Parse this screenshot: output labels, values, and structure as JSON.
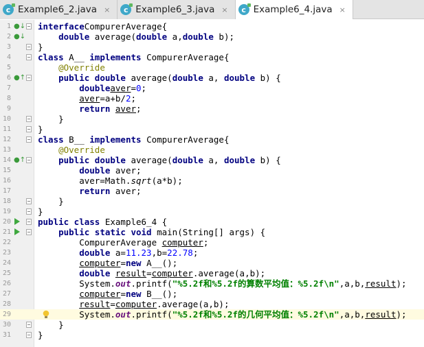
{
  "tabs": [
    {
      "icon": "class-icon",
      "label": "Example6_2.java",
      "active": false
    },
    {
      "icon": "class-icon",
      "label": "Example6_3.java",
      "active": false
    },
    {
      "icon": "class-icon",
      "label": "Example6_4.java",
      "active": true
    }
  ],
  "tab_close_glyph": "×",
  "lines": [
    {
      "n": "1",
      "marker": "impl",
      "fold": true,
      "tokens": [
        [
          "kw",
          "interface"
        ],
        [
          "",
          "CompurerAverage{"
        ]
      ]
    },
    {
      "n": "2",
      "marker": "impl",
      "fold": false,
      "tokens": [
        [
          "",
          "    "
        ],
        [
          "kw",
          "double"
        ],
        [
          "",
          " average("
        ],
        [
          "kw",
          "double"
        ],
        [
          "",
          " a,"
        ],
        [
          "kw",
          "double"
        ],
        [
          "",
          " b);"
        ]
      ]
    },
    {
      "n": "3",
      "marker": "",
      "fold": true,
      "tokens": [
        [
          "",
          "}"
        ]
      ]
    },
    {
      "n": "4",
      "marker": "",
      "fold": true,
      "tokens": [
        [
          "kw",
          "class"
        ],
        [
          "",
          " A__ "
        ],
        [
          "kw",
          "implements"
        ],
        [
          "",
          " CompurerAverage{"
        ]
      ]
    },
    {
      "n": "5",
      "marker": "",
      "fold": false,
      "tokens": [
        [
          "",
          "    "
        ],
        [
          "ann",
          "@Override"
        ]
      ]
    },
    {
      "n": "6",
      "marker": "override",
      "fold": true,
      "tokens": [
        [
          "",
          "    "
        ],
        [
          "kw",
          "public double"
        ],
        [
          "",
          " average("
        ],
        [
          "kw",
          "double"
        ],
        [
          "",
          " a, "
        ],
        [
          "kw",
          "double"
        ],
        [
          "",
          " b) {"
        ]
      ]
    },
    {
      "n": "7",
      "marker": "",
      "fold": false,
      "tokens": [
        [
          "",
          "        "
        ],
        [
          "kw",
          "double"
        ],
        [
          " ",
          ""
        ],
        [
          "ul",
          "aver"
        ],
        [
          "",
          "="
        ],
        [
          "num",
          "0"
        ],
        [
          "",
          ";"
        ]
      ]
    },
    {
      "n": "8",
      "marker": "",
      "fold": false,
      "tokens": [
        [
          "",
          "        "
        ],
        [
          "ul",
          "aver"
        ],
        [
          "",
          "=a+b/"
        ],
        [
          "num",
          "2"
        ],
        [
          "",
          ";"
        ]
      ]
    },
    {
      "n": "9",
      "marker": "",
      "fold": false,
      "tokens": [
        [
          "",
          "        "
        ],
        [
          "kw",
          "return"
        ],
        [
          "",
          " "
        ],
        [
          "ul",
          "aver"
        ],
        [
          "",
          ";"
        ]
      ]
    },
    {
      "n": "10",
      "marker": "",
      "fold": true,
      "tokens": [
        [
          "",
          "    }"
        ]
      ]
    },
    {
      "n": "11",
      "marker": "",
      "fold": true,
      "tokens": [
        [
          "",
          "}"
        ]
      ]
    },
    {
      "n": "12",
      "marker": "",
      "fold": true,
      "tokens": [
        [
          "kw",
          "class"
        ],
        [
          "",
          " B__ "
        ],
        [
          "kw",
          "implements"
        ],
        [
          "",
          " CompurerAverage{"
        ]
      ]
    },
    {
      "n": "13",
      "marker": "",
      "fold": false,
      "tokens": [
        [
          "",
          "    "
        ],
        [
          "ann",
          "@Override"
        ]
      ]
    },
    {
      "n": "14",
      "marker": "override",
      "fold": true,
      "tokens": [
        [
          "",
          "    "
        ],
        [
          "kw",
          "public double"
        ],
        [
          "",
          " average("
        ],
        [
          "kw",
          "double"
        ],
        [
          "",
          " a, "
        ],
        [
          "kw",
          "double"
        ],
        [
          "",
          " b) {"
        ]
      ]
    },
    {
      "n": "15",
      "marker": "",
      "fold": false,
      "tokens": [
        [
          "",
          "        "
        ],
        [
          "kw",
          "double"
        ],
        [
          "",
          " aver;"
        ]
      ]
    },
    {
      "n": "16",
      "marker": "",
      "fold": false,
      "tokens": [
        [
          "",
          "        aver=Math."
        ],
        [
          "ita",
          "sqrt"
        ],
        [
          "",
          "(a*b);"
        ]
      ]
    },
    {
      "n": "17",
      "marker": "",
      "fold": false,
      "tokens": [
        [
          "",
          "        "
        ],
        [
          "kw",
          "return"
        ],
        [
          "",
          " aver;"
        ]
      ]
    },
    {
      "n": "18",
      "marker": "",
      "fold": true,
      "tokens": [
        [
          "",
          "    }"
        ]
      ]
    },
    {
      "n": "19",
      "marker": "",
      "fold": true,
      "tokens": [
        [
          "",
          "}"
        ]
      ]
    },
    {
      "n": "20",
      "marker": "run",
      "fold": true,
      "tokens": [
        [
          "kw",
          "public class"
        ],
        [
          "",
          " Example6_4 {"
        ]
      ]
    },
    {
      "n": "21",
      "marker": "run",
      "fold": true,
      "tokens": [
        [
          "",
          "    "
        ],
        [
          "kw",
          "public static void"
        ],
        [
          "",
          " main(String[] args) {"
        ]
      ]
    },
    {
      "n": "22",
      "marker": "",
      "fold": false,
      "tokens": [
        [
          "",
          "        CompurerAverage "
        ],
        [
          "ul",
          "computer"
        ],
        [
          "",
          ";"
        ]
      ]
    },
    {
      "n": "23",
      "marker": "",
      "fold": false,
      "tokens": [
        [
          "",
          "        "
        ],
        [
          "kw",
          "double"
        ],
        [
          "",
          " a="
        ],
        [
          "num",
          "11.23"
        ],
        [
          "",
          ",b="
        ],
        [
          "num",
          "22.78"
        ],
        [
          "",
          ";"
        ]
      ]
    },
    {
      "n": "24",
      "marker": "",
      "fold": false,
      "tokens": [
        [
          "",
          "        "
        ],
        [
          "ul",
          "computer"
        ],
        [
          "",
          "="
        ],
        [
          "kw",
          "new"
        ],
        [
          "",
          " A__();"
        ]
      ]
    },
    {
      "n": "25",
      "marker": "",
      "fold": false,
      "tokens": [
        [
          "",
          "        "
        ],
        [
          "kw",
          "double"
        ],
        [
          "",
          " "
        ],
        [
          "ul",
          "result"
        ],
        [
          "",
          "="
        ],
        [
          "ul",
          "computer"
        ],
        [
          "",
          ".average(a,b);"
        ]
      ]
    },
    {
      "n": "26",
      "marker": "",
      "fold": false,
      "tokens": [
        [
          "",
          "        System."
        ],
        [
          "fld",
          "out"
        ],
        [
          "",
          ".printf("
        ],
        [
          "str",
          "\"%5.2f和%5.2f的算数平均值：%5.2f\\n\""
        ],
        [
          "",
          ",a,b,"
        ],
        [
          "ul",
          "result"
        ],
        [
          "",
          ");"
        ]
      ]
    },
    {
      "n": "27",
      "marker": "",
      "fold": false,
      "tokens": [
        [
          "",
          "        "
        ],
        [
          "ul",
          "computer"
        ],
        [
          "",
          "="
        ],
        [
          "kw",
          "new"
        ],
        [
          "",
          " B__();"
        ]
      ]
    },
    {
      "n": "28",
      "marker": "",
      "fold": false,
      "tokens": [
        [
          "",
          "        "
        ],
        [
          "ul",
          "result"
        ],
        [
          "",
          "="
        ],
        [
          "ul",
          "computer"
        ],
        [
          "",
          ".average(a,b);"
        ]
      ]
    },
    {
      "n": "29",
      "marker": "bulb",
      "fold": false,
      "current": true,
      "tokens": [
        [
          "",
          "        System."
        ],
        [
          "fld",
          "out"
        ],
        [
          "",
          ".printf("
        ],
        [
          "str",
          "\"%5.2f和%5.2f的几何平均值：%5.2f\\n\""
        ],
        [
          "",
          ",a,b,"
        ],
        [
          "ul",
          "result"
        ],
        [
          "",
          ");"
        ]
      ]
    },
    {
      "n": "30",
      "marker": "",
      "fold": true,
      "tokens": [
        [
          "",
          "    }"
        ]
      ]
    },
    {
      "n": "31",
      "marker": "",
      "fold": true,
      "tokens": [
        [
          "",
          "}"
        ]
      ]
    }
  ],
  "marker_glyphs": {
    "impl": "●↓",
    "override": "●↑"
  }
}
